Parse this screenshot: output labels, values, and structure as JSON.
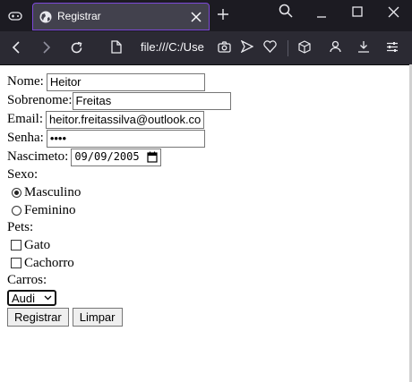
{
  "browser": {
    "tab_title": "Registrar",
    "url": "file:///C:/Use",
    "accent": "#7c48d8"
  },
  "form": {
    "nome_label": "Nome:",
    "nome_value": "Heitor",
    "sobrenome_label": "Sobrenome:",
    "sobrenome_value": "Freitas",
    "email_label": "Email:",
    "email_value": "heitor.freitassilva@outlook.co",
    "senha_label": "Senha:",
    "senha_value": "••••",
    "nascimento_label": "Nascimeto:",
    "nascimento_day": "09",
    "nascimento_month": "09",
    "nascimento_year": "2005",
    "sexo_label": "Sexo:",
    "sexo_options": [
      "Masculino",
      "Feminino"
    ],
    "sexo_selected": "Masculino",
    "pets_label": "Pets:",
    "pets_options": [
      "Gato",
      "Cachorro"
    ],
    "carros_label": "Carros:",
    "carros_selected": "Audi",
    "registrar_label": "Registrar",
    "limpar_label": "Limpar"
  }
}
